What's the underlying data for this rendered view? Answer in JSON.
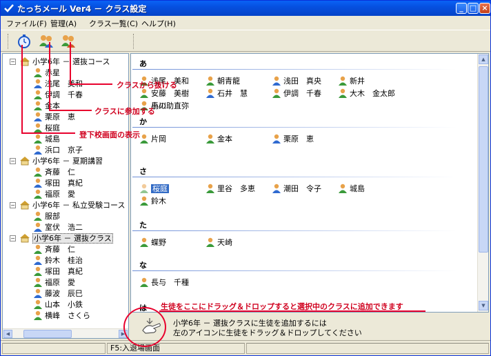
{
  "window": {
    "title": "たっちメール Ver4 － クラス設定"
  },
  "menubar": [
    "ファイル(F)",
    "管理(A)",
    "クラス一覧(C)",
    "ヘルプ(H)"
  ],
  "toolbar": {
    "icons": [
      "stopwatch-icon",
      "join-class-icon",
      "leave-class-icon"
    ]
  },
  "tree": {
    "classes": [
      {
        "label": "小学6年 － 選抜コース",
        "students": [
          "赤星",
          "浅尾　美和",
          "伊調　千春",
          "金本",
          "栗原　恵",
          "桜庭",
          "城島",
          "浜口　京子"
        ]
      },
      {
        "label": "小学6年 － 夏期講習",
        "students": [
          "斉藤　仁",
          "塚田　真紀",
          "福原　愛"
        ]
      },
      {
        "label": "小学6年 － 私立受験コース",
        "students": [
          "服部",
          "室伏　浩二"
        ]
      },
      {
        "label": "小学6年 － 選抜クラス",
        "students": [
          "斉藤　仁",
          "鈴木　桂治",
          "塚田　真紀",
          "福原　愛",
          "藤波　辰巳",
          "山本　小鉄",
          "横峰　さくら"
        ]
      }
    ]
  },
  "main": {
    "sections": [
      {
        "head": "あ",
        "students": [
          "浅尾　美和",
          "朝青龍",
          "浅田　真央",
          "新井",
          "安藤　美樹",
          "石井　慧",
          "伊調　千春",
          "大木　金太郎",
          "小川　直弥"
        ],
        "partial": "馬の助"
      },
      {
        "head": "か",
        "students": [
          "片岡",
          "金本",
          "栗原　恵"
        ]
      },
      {
        "head": "さ",
        "students": [
          "桜庭",
          "里谷　多恵",
          "潮田　令子",
          "城島",
          "鈴木"
        ]
      },
      {
        "head": "た",
        "students": [
          "蝶野",
          "天崎"
        ]
      },
      {
        "head": "な",
        "students": [
          "長与　千種"
        ]
      },
      {
        "head": "は",
        "students": []
      }
    ]
  },
  "drop_area": {
    "line1": "小学6年 － 選抜クラスに生徒を追加するには",
    "line2": "左のアイコンに生徒をドラッグ＆ドロップしてください"
  },
  "status": {
    "cell1": "",
    "cell2": "F5:入退場画面",
    "cell3": ""
  },
  "annotations": {
    "leave": "クラスから抜ける",
    "join": "クラスに参加する",
    "attendance": "登下校画面の表示",
    "dragdrop": "生徒をここにドラッグ＆ドロップすると選択中のクラスに追加できます"
  },
  "colors": {
    "annotation": "#e8002c",
    "selection": "#316ac5",
    "titlebar": "#0650e0"
  }
}
